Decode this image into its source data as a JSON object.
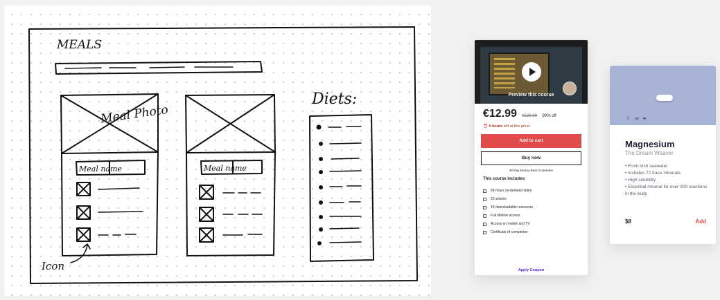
{
  "sketch": {
    "title": "MEALS",
    "card1_photo_label": "Meal Photo",
    "card1_header": "Meal name",
    "card2_header": "Meal name",
    "diets_label": "Diets:",
    "annotation": "Icon"
  },
  "course_card": {
    "preview_label": "Preview this course",
    "price": "€12.99",
    "old_price": "€129.99",
    "discount": "90% off",
    "timer_bold": "5 hours",
    "timer_rest": "left at this price!",
    "add_to_cart": "Add to cart",
    "buy_now": "Buy now",
    "guarantee": "30-Day Money-Back Guarantee",
    "includes_title": "This course includes:",
    "includes": [
      "68 hours on-demand video",
      "20 articles",
      "18 downloadable resources",
      "Full lifetime access",
      "Access on mobile and TV",
      "Certificate of completion"
    ],
    "apply_coupon": "Apply Coupon"
  },
  "product_card": {
    "hero_color": "#a7b3d6",
    "icons": [
      "moon-icon",
      "infinity-icon",
      "link-icon"
    ],
    "title": "Magnesium",
    "subtitle": "The Dream Weaver",
    "bullets": [
      "• From Irish seawater",
      "• Includes 72 trace minerals",
      "• High solubility",
      "• Essential mineral for over 300 reactions in the body"
    ],
    "price": "$8",
    "add_label": "Add"
  }
}
